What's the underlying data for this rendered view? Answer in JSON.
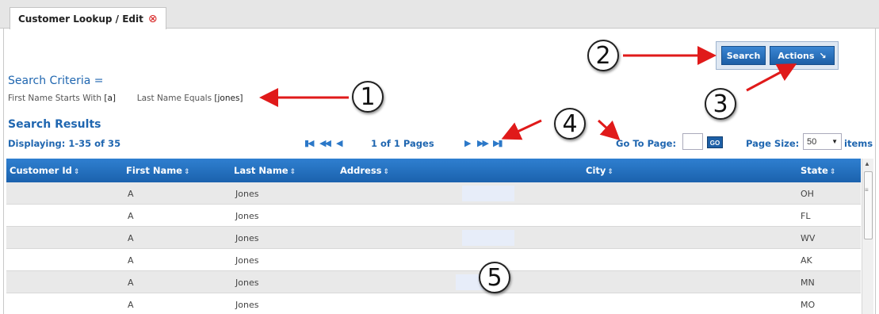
{
  "tab": {
    "title": "Customer Lookup / Edit",
    "close_icon": "⊗"
  },
  "criteria": {
    "title": "Search Criteria =",
    "first_label": "First Name Starts With",
    "first_value": "[a]",
    "last_label": "Last Name Equals",
    "last_value": "[jones]"
  },
  "results": {
    "title": "Search Results",
    "displaying": "Displaying: 1-35 of 35"
  },
  "pager": {
    "pages_text": "1 of 1 Pages",
    "goto_label": "Go To Page:",
    "goto_value": "",
    "go_label": "GO",
    "page_size_label": "Page Size:",
    "page_size_value": "50",
    "items_label": "items"
  },
  "toolbar": {
    "search_label": "Search",
    "actions_label": "Actions",
    "actions_icon": "↘"
  },
  "grid": {
    "columns": [
      "Customer Id",
      "First Name",
      "Last Name",
      "Address",
      "City",
      "State"
    ],
    "rows": [
      {
        "customer_id": "",
        "first_name": "A",
        "last_name": "Jones",
        "address": "",
        "city": "",
        "state": "OH"
      },
      {
        "customer_id": "",
        "first_name": "A",
        "last_name": "Jones",
        "address": "",
        "city": "",
        "state": "FL"
      },
      {
        "customer_id": "",
        "first_name": "A",
        "last_name": "Jones",
        "address": "",
        "city": "",
        "state": "WV"
      },
      {
        "customer_id": "",
        "first_name": "A",
        "last_name": "Jones",
        "address": "",
        "city": "",
        "state": "AK"
      },
      {
        "customer_id": "",
        "first_name": "A",
        "last_name": "Jones",
        "address": "",
        "city": "",
        "state": "MN"
      },
      {
        "customer_id": "",
        "first_name": "A",
        "last_name": "Jones",
        "address": "",
        "city": "",
        "state": "MO"
      }
    ]
  },
  "callouts": [
    "1",
    "2",
    "3",
    "4",
    "5"
  ],
  "colors": {
    "header_blue": "#1b62ad",
    "link_blue": "#1f66b0",
    "arrow_red": "#e01a1a",
    "row_alt": "#e9e9e9"
  }
}
